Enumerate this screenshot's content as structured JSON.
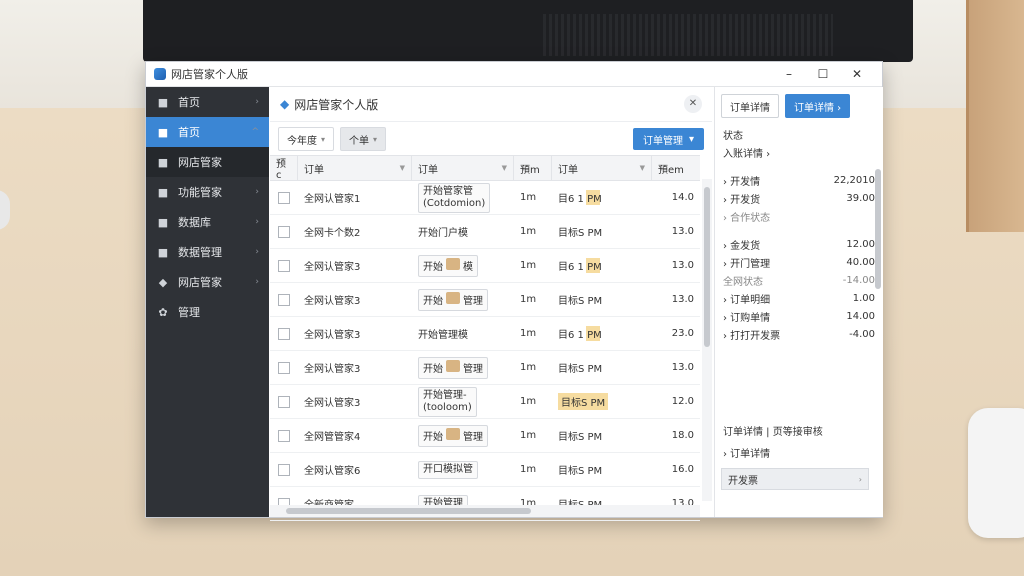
{
  "window": {
    "title": "网店管家个人版",
    "min": "–",
    "max": "☐",
    "close": "✕"
  },
  "sidebar": {
    "items": [
      {
        "icon": "■",
        "label": "首页",
        "arrow": "›",
        "state": "normal"
      },
      {
        "icon": "■",
        "label": "首页",
        "arrow": "^",
        "state": "active"
      },
      {
        "icon": "■",
        "label": "网店管家",
        "arrow": "",
        "state": "sub"
      },
      {
        "icon": "■",
        "label": "功能管家",
        "arrow": "›",
        "state": "normal"
      },
      {
        "icon": "■",
        "label": "数据库",
        "arrow": "›",
        "state": "normal"
      },
      {
        "icon": "■",
        "label": "数据管理",
        "arrow": "›",
        "state": "normal"
      },
      {
        "icon": "◆",
        "label": "网店管家",
        "arrow": "›",
        "state": "normal"
      },
      {
        "icon": "✿",
        "label": "管理",
        "arrow": "",
        "state": "normal"
      }
    ]
  },
  "main": {
    "title": "网店管家个人版",
    "close": "✕",
    "toolbar": {
      "filter1": "今年度",
      "filter2": "个单",
      "action": "订单管理"
    },
    "columns": [
      "订单",
      "订单",
      "订单",
      "預m",
      "订单",
      "預em"
    ],
    "rows": [
      {
        "name": "全网认管家1",
        "item": "开始管家管",
        "item2": "(Cotdomion)",
        "pkg": false,
        "qty": "1m",
        "time": "目6 1 PM",
        "hl": "1",
        "amt": "14.0"
      },
      {
        "name": "全网卡个数2",
        "item": "开始门户模",
        "item2": "",
        "pkg": false,
        "qty": "1m",
        "time": "目标S PM",
        "hl": "",
        "amt": "13.0"
      },
      {
        "name": "全网认管家3",
        "item": "开始",
        "item2": "模",
        "pkg": true,
        "qty": "1m",
        "time": "目6 1 PM",
        "hl": "1",
        "amt": "13.0"
      },
      {
        "name": "全网认管家3",
        "item": "开始",
        "item2": "管理",
        "pkg": true,
        "qty": "1m",
        "time": "目标S PM",
        "hl": "",
        "amt": "13.0"
      },
      {
        "name": "全网认管家3",
        "item": "开始管理模",
        "item2": "",
        "pkg": false,
        "qty": "1m",
        "time": "目6 1 PM",
        "hl": "1",
        "amt": "23.0"
      },
      {
        "name": "全网认管家3",
        "item": "开始",
        "item2": "管理",
        "pkg": true,
        "qty": "1m",
        "time": "目标S PM",
        "hl": "",
        "amt": "13.0"
      },
      {
        "name": "全网认管家3",
        "item": "开始管理-",
        "item2": "(tooloom)",
        "pkg": false,
        "qty": "1m",
        "time": "目标S PM",
        "hl": "row",
        "amt": "12.0"
      },
      {
        "name": "全网管管家4",
        "item": "开始",
        "item2": "管理",
        "pkg": true,
        "qty": "1m",
        "time": "目标S PM",
        "hl": "",
        "amt": "18.0"
      },
      {
        "name": "全网认管家6",
        "item": "开口模拟管",
        "item2": "",
        "pkg": false,
        "qty": "1m",
        "time": "目标S PM",
        "hl": "",
        "amt": "16.0"
      },
      {
        "name": "全新商管家",
        "item": "开始管理",
        "item2": "",
        "pkg": false,
        "qty": "1m",
        "time": "目标S PM",
        "hl": "",
        "amt": "13.0"
      }
    ]
  },
  "panel": {
    "tab1": "订单详情",
    "tab2": "订单详情 ›",
    "heading": "状态",
    "sub": "入账详情 ›",
    "group1": [
      {
        "k": "› 开发情",
        "v": "22,2010"
      },
      {
        "k": "› 开发货",
        "v": "39.00"
      },
      {
        "k": "› 合作状态",
        "v": "",
        "muted": true
      }
    ],
    "group2": [
      {
        "k": "› 金发货",
        "v": "12.00"
      },
      {
        "k": "› 开门管理",
        "v": "40.00"
      },
      {
        "k": "  全网状态",
        "v": "-14.00",
        "muted": true
      },
      {
        "k": "› 订单明细",
        "v": "1.00"
      },
      {
        "k": "› 订购单情",
        "v": "14.00"
      },
      {
        "k": "› 打打开发票",
        "v": "-4.00"
      }
    ],
    "summary": "订单详情 | 页等接审核",
    "summary2": "› 订单详情",
    "footer": "开发票"
  }
}
